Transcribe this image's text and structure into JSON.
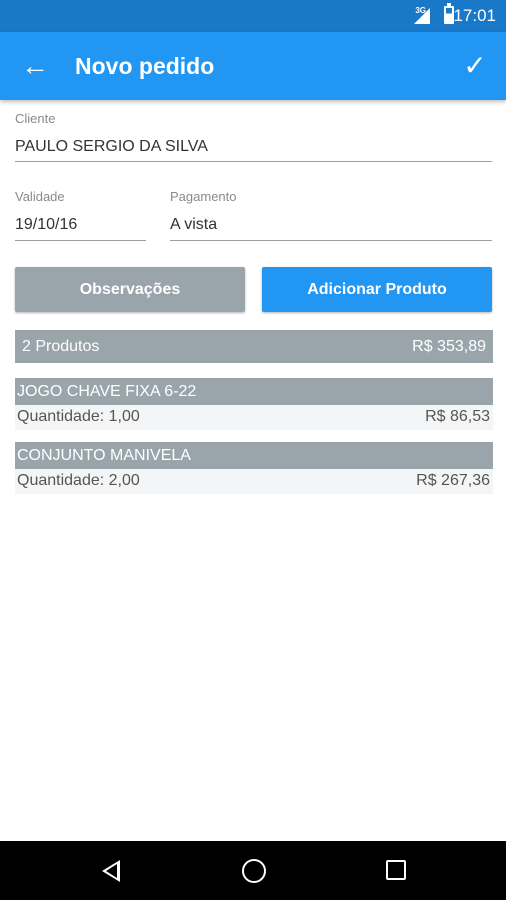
{
  "status": {
    "network": "3G",
    "time": "17:01"
  },
  "app_bar": {
    "title": "Novo pedido",
    "back_icon": "←",
    "confirm_icon": "✓"
  },
  "form": {
    "cliente_label": "Cliente",
    "cliente_value": "PAULO SERGIO DA SILVA",
    "validade_label": "Validade",
    "validade_value": "19/10/16",
    "pagamento_label": "Pagamento",
    "pagamento_value": "A vista"
  },
  "buttons": {
    "observacoes": "Observações",
    "adicionar": "Adicionar Produto"
  },
  "colors": {
    "primary": "#2196f3",
    "status_bar": "#1a78c8",
    "gray": "#99a4ab"
  },
  "summary": {
    "count": "2 Produtos",
    "total": "R$ 353,89"
  },
  "products": [
    {
      "name": "JOGO CHAVE FIXA 6-22",
      "quantity": "Quantidade: 1,00",
      "price": "R$ 86,53"
    },
    {
      "name": "CONJUNTO MANIVELA",
      "quantity": "Quantidade: 2,00",
      "price": "R$ 267,36"
    }
  ]
}
